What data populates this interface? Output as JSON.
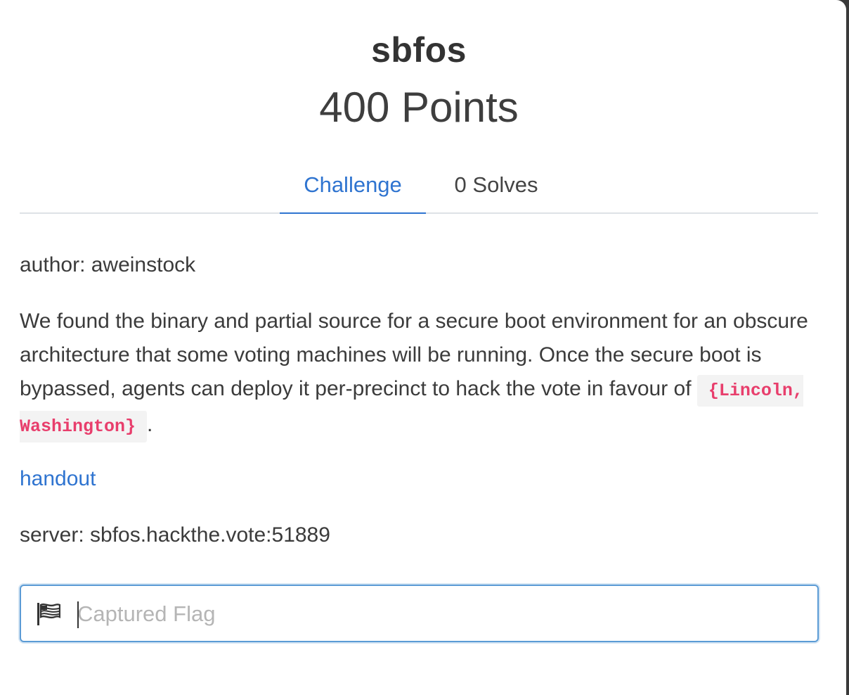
{
  "challenge": {
    "title": "sbfos",
    "points": "400 Points"
  },
  "tabs": [
    {
      "label": "Challenge",
      "active": true
    },
    {
      "label": "0 Solves",
      "active": false
    }
  ],
  "body": {
    "author": "author: aweinstock",
    "description": "We found the binary and partial source for a secure boot environment for an obscure architecture that some voting machines will be running. Once the secure boot is bypassed, agents can deploy it per-precinct to hack the vote in favour of ",
    "code": "{Lincoln, Washington}",
    "description_end": ".",
    "handout_link": "handout",
    "server": "server: sbfos.hackthe.vote:51889"
  },
  "flag_input": {
    "placeholder": "Captured Flag",
    "value": "",
    "icon": "flag-usa-icon"
  },
  "colors": {
    "accent": "#2f74d0",
    "code": "#e83e6c",
    "input_focus": "#5b9bd5"
  }
}
